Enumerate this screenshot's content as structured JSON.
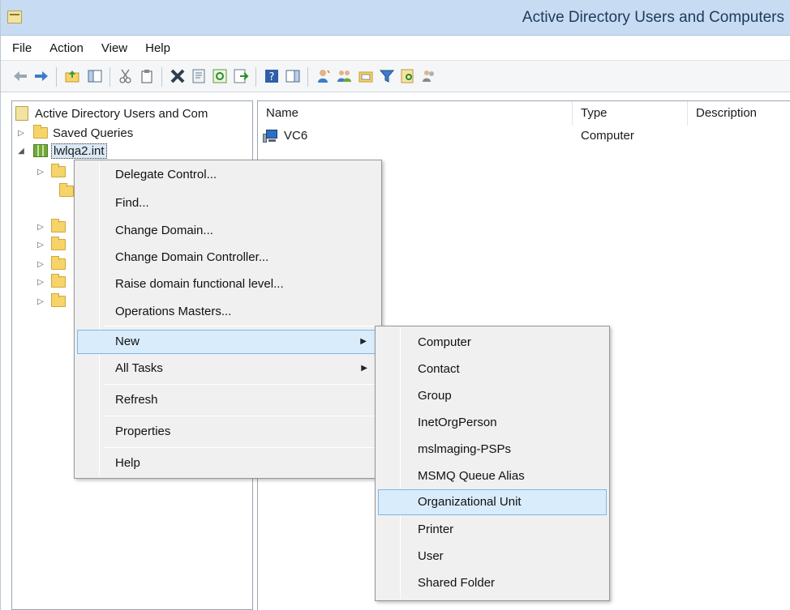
{
  "window": {
    "title": "Active Directory Users and Computers"
  },
  "menubar": {
    "items": [
      "File",
      "Action",
      "View",
      "Help"
    ]
  },
  "toolbar": {
    "icons": [
      "back-icon",
      "forward-icon",
      "up-folder-icon",
      "show-hide-console-tree-icon",
      "cut-icon",
      "copy-icon",
      "delete-icon",
      "properties-icon",
      "refresh-icon",
      "export-list-icon",
      "help-icon",
      "action-pane-icon",
      "new-user-icon",
      "new-group-icon",
      "new-ou-icon",
      "filter-icon",
      "find-icon",
      "add-to-group-icon"
    ]
  },
  "tree": {
    "root": "Active Directory Users and Com",
    "saved_queries": "Saved Queries",
    "domain": "lwlqa2.int"
  },
  "list": {
    "columns": [
      "Name",
      "Type",
      "Description"
    ],
    "rows": [
      {
        "name": "VC6",
        "type": "Computer",
        "description": ""
      }
    ]
  },
  "context_menu": {
    "delegate_control": "Delegate Control...",
    "find": "Find...",
    "change_domain": "Change Domain...",
    "change_dc": "Change Domain Controller...",
    "raise_level": "Raise domain functional level...",
    "operations_masters": "Operations Masters...",
    "new": "New",
    "all_tasks": "All Tasks",
    "refresh": "Refresh",
    "properties": "Properties",
    "help": "Help"
  },
  "submenu": {
    "items": [
      "Computer",
      "Contact",
      "Group",
      "InetOrgPerson",
      "mslmaging-PSPs",
      "MSMQ Queue Alias",
      "Organizational Unit",
      "Printer",
      "User",
      "Shared Folder"
    ],
    "highlighted": "Organizational Unit"
  },
  "colors": {
    "titlebar": "#c7dcf2",
    "highlight": "#d9ecfb",
    "highlight_border": "#7fb6e6"
  }
}
